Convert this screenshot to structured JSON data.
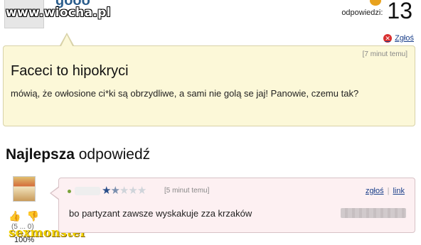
{
  "header": {
    "username": "gooo",
    "watermark": "www.wiocha.pl",
    "answers_label": "odpowiedzi:",
    "answers_count": "13",
    "report_label": "Zgłoś"
  },
  "question": {
    "time": "[7 minut temu]",
    "title": "Faceci to hipokryci",
    "body": "mówią, że owłosione ci*ki są obrzydliwe, a sami nie golą se jaj! Panowie, czemu tak?"
  },
  "best_answer": {
    "heading_bold": "Najlepsza",
    "heading_rest": "odpowiedź",
    "time": "[5 minut temu]",
    "rating_stars": 1.5,
    "rating_max": 5,
    "links": {
      "report": "zgłoś",
      "separator": "|",
      "link": "link"
    },
    "text": "bo partyzant zawsze wyskakuje zza krzaków",
    "vote_counts": "(5 ... 0)",
    "percent": "100%",
    "signature_watermark": "sexmonster"
  },
  "colors": {
    "question_bg": "#fcf8d8",
    "answer_bg": "#fdf0f2",
    "link": "#1a3f8a",
    "username": "#2b5d8c"
  },
  "icons": {
    "report": "report-icon",
    "thumb_up": "thumb-up-icon",
    "thumb_down": "thumb-down-icon",
    "star": "star-icon",
    "coin": "coin-icon"
  }
}
